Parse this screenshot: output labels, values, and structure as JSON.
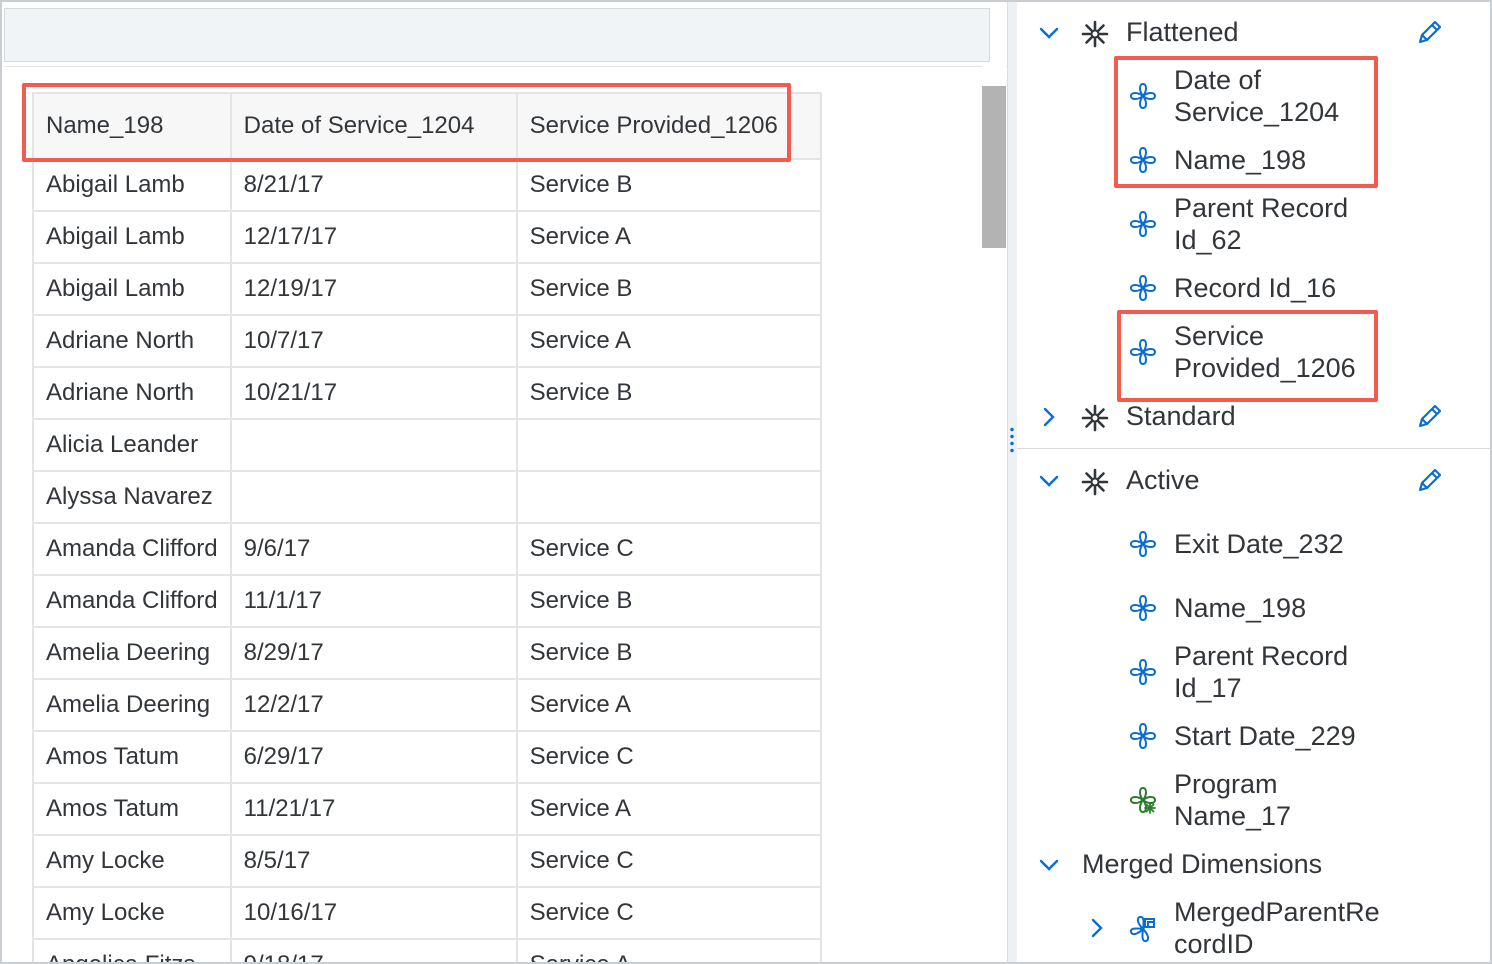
{
  "table": {
    "columns": [
      "Name_198",
      "Date of Service_1204",
      "Service Provided_1206"
    ],
    "rows": [
      [
        "Abigail Lamb",
        "8/21/17",
        "Service B"
      ],
      [
        "Abigail Lamb",
        "12/17/17",
        "Service A"
      ],
      [
        "Abigail Lamb",
        "12/19/17",
        "Service B"
      ],
      [
        "Adriane North",
        "10/7/17",
        "Service A"
      ],
      [
        "Adriane North",
        "10/21/17",
        "Service B"
      ],
      [
        "Alicia Leander",
        "",
        ""
      ],
      [
        "Alyssa Navarez",
        "",
        ""
      ],
      [
        "Amanda Clifford",
        "9/6/17",
        "Service C"
      ],
      [
        "Amanda Clifford",
        "11/1/17",
        "Service B"
      ],
      [
        "Amelia Deering",
        "8/29/17",
        "Service B"
      ],
      [
        "Amelia Deering",
        "12/2/17",
        "Service A"
      ],
      [
        "Amos Tatum",
        "6/29/17",
        "Service C"
      ],
      [
        "Amos Tatum",
        "11/21/17",
        "Service A"
      ],
      [
        "Amy Locke",
        "8/5/17",
        "Service C"
      ],
      [
        "Amy Locke",
        "10/16/17",
        "Service C"
      ],
      [
        "Angelica Fitzs",
        "9/18/17",
        "Service A"
      ]
    ]
  },
  "tree": {
    "flattened": {
      "label": "Flattened",
      "items": [
        {
          "line1": "Date of",
          "line2": "Service_1204"
        },
        {
          "line1": "Name_198",
          "line2": ""
        },
        {
          "line1": "Parent Record",
          "line2": "Id_62"
        },
        {
          "line1": "Record Id_16",
          "line2": ""
        },
        {
          "line1": "Service",
          "line2": "Provided_1206"
        }
      ]
    },
    "standard": {
      "label": "Standard"
    },
    "active": {
      "label": "Active",
      "items": [
        {
          "line1": "Exit Date_232",
          "line2": ""
        },
        {
          "line1": "Name_198",
          "line2": ""
        },
        {
          "line1": "Parent Record",
          "line2": "Id_17"
        },
        {
          "line1": "Start Date_229",
          "line2": ""
        },
        {
          "line1": "Program",
          "line2": "Name_17"
        }
      ]
    },
    "merged": {
      "label": "Merged Dimensions",
      "items": [
        {
          "line1": "MergedParentRe",
          "line2": "cordID"
        }
      ]
    }
  },
  "colors": {
    "highlight": "#f15b50",
    "dimension_icon": "#0a6ed1",
    "program_icon": "#2b7c2b",
    "text": "#32363a"
  },
  "icons": {
    "expand": "chevron-down-icon",
    "collapse": "chevron-right-icon",
    "group": "hierarchy-star-icon",
    "dimension": "dimension-icon",
    "edit": "pencil-icon"
  }
}
